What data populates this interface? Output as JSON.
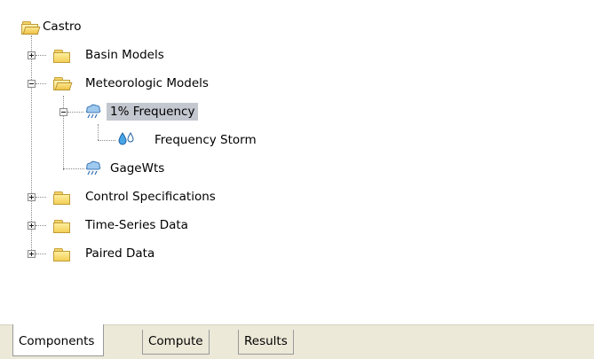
{
  "tree": {
    "root": "Castro",
    "basin_models": "Basin Models",
    "meteorologic_models": "Meteorologic Models",
    "frequency_model": "1% Frequency",
    "frequency_storm": "Frequency Storm",
    "gagewts": "GageWts",
    "control_specifications": "Control Specifications",
    "time_series_data": "Time-Series Data",
    "paired_data": "Paired Data"
  },
  "tabs": [
    "Components",
    "Compute",
    "Results"
  ],
  "colors": {
    "selection": "#c3c7cf",
    "folder": "#f2cf57",
    "tab_bg": "#ece9d8"
  },
  "icons": {
    "folder": "folder-icon",
    "folder_open": "folder-open-icon",
    "met_model": "meteorologic-model-icon",
    "precip": "precipitation-drops-icon"
  }
}
